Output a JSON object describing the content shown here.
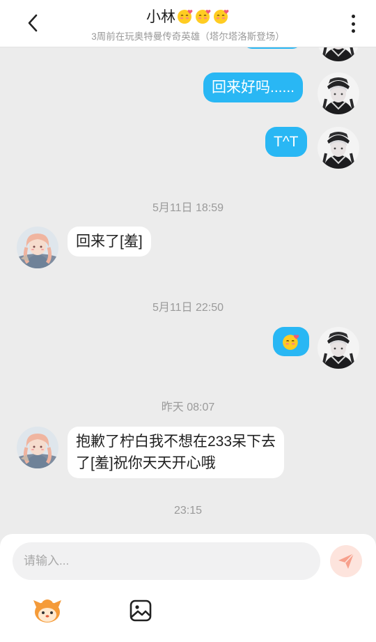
{
  "header": {
    "title": "小林",
    "subtitle": "3周前在玩奥特曼传奇英雄（塔尔塔洛斯登场）",
    "title_emoji_count": 3,
    "back_icon": "chevron-left-icon",
    "more_icon": "more-vertical-icon"
  },
  "messages": [
    {
      "type": "outgoing",
      "text": "回来好吗......"
    },
    {
      "type": "outgoing",
      "text": "T^T"
    },
    {
      "type": "timestamp",
      "text": "5月11日 18:59"
    },
    {
      "type": "incoming",
      "text": "回来了[羞]"
    },
    {
      "type": "timestamp",
      "text": "5月11日 22:50"
    },
    {
      "type": "outgoing",
      "emoji": "shy-face-emoji"
    },
    {
      "type": "timestamp",
      "text": "昨天 08:07"
    },
    {
      "type": "incoming",
      "lines": [
        "抱歉了柠白我不想在233呆下去",
        "了[羞]祝你天天开心哦"
      ]
    },
    {
      "type": "timestamp",
      "text": "23:15"
    }
  ],
  "input": {
    "placeholder": "请输入...",
    "value": ""
  },
  "toolbar": {
    "sticker_icon": "mascot-sticker-icon",
    "image_icon": "image-icon",
    "send_icon": "send-icon"
  },
  "colors": {
    "outgoing_bubble": "#29b7f4",
    "incoming_bubble": "#ffffff",
    "background": "#ececec",
    "send_button": "#fde4dd",
    "send_arrow": "#f7a08c"
  }
}
